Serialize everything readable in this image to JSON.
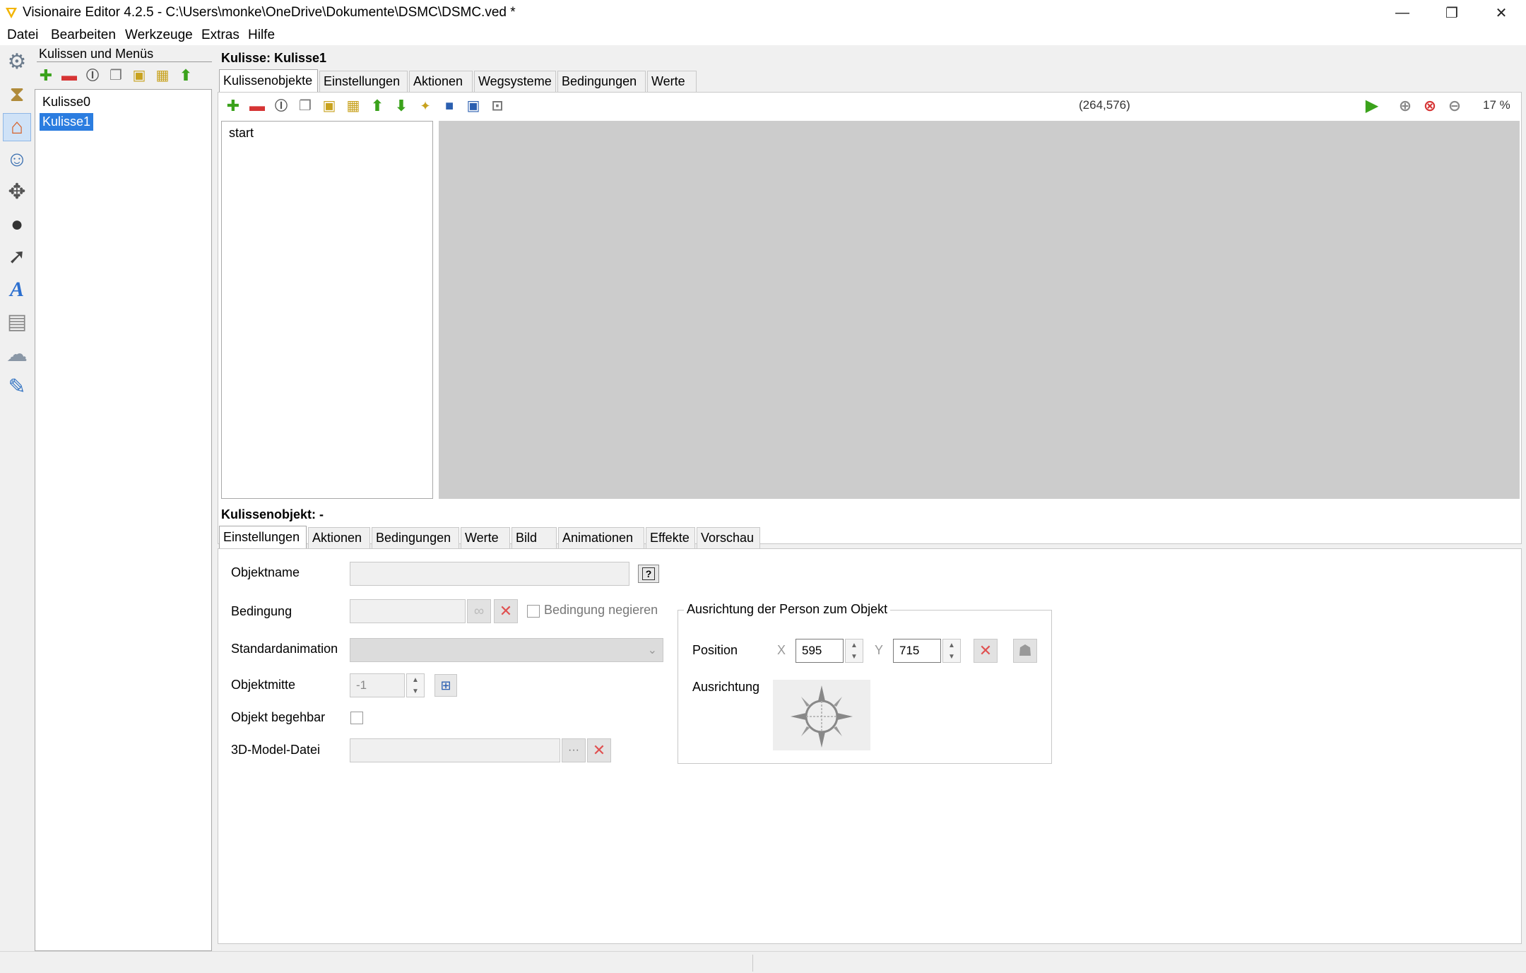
{
  "window": {
    "title": "Visionaire Editor 4.2.5 - C:\\Users\\monke\\OneDrive\\Dokumente\\DSMC\\DSMC.ved *",
    "minimize_glyph": "—",
    "restore_glyph": "❐",
    "close_glyph": "✕"
  },
  "menu": [
    "Datei",
    "Bearbeiten",
    "Werkzeuge",
    "Extras",
    "Hilfe"
  ],
  "rail_icons": [
    "gear-icon",
    "hourglass-icon",
    "home-icon",
    "character-icon",
    "gamepad-icon",
    "ball-icon",
    "cursor-icon",
    "font-icon",
    "text-document-icon",
    "weather-icon",
    "script-icon"
  ],
  "scenes_panel": {
    "title": "Kulissen und Menüs",
    "items": [
      "Kulisse0",
      "Kulisse1"
    ],
    "selected": "Kulisse1"
  },
  "scene": {
    "header": "Kulisse: Kulisse1",
    "tabs": [
      "Kulissenobjekte",
      "Einstellungen",
      "Aktionen",
      "Wegsysteme",
      "Bedingungen",
      "Werte"
    ],
    "active_tab": "Kulissenobjekte",
    "objects": [
      "start"
    ],
    "coordinates": "(264,576)",
    "zoom": "17 %"
  },
  "object": {
    "header": "Kulissenobjekt: -",
    "tabs": [
      "Einstellungen",
      "Aktionen",
      "Bedingungen",
      "Werte",
      "Bild",
      "Animationen",
      "Effekte",
      "Vorschau"
    ],
    "active_tab": "Einstellungen",
    "labels": {
      "name": "Objektname",
      "condition": "Bedingung",
      "negate": "Bedingung negieren",
      "animation": "Standardanimation",
      "center": "Objektmitte",
      "walkable": "Objekt begehbar",
      "model": "3D-Model-Datei"
    },
    "center_value": "-1",
    "help_glyph": "?",
    "browse_glyph": "···",
    "link_glyph": "∞"
  },
  "orientation": {
    "group_title": "Ausrichtung der Person zum Objekt",
    "position_label": "Position",
    "x_label": "X",
    "x_value": "595",
    "y_label": "Y",
    "y_value": "715",
    "direction_label": "Ausrichtung",
    "direction_value": "-"
  },
  "colors": {
    "accent": "#2b7de0",
    "canvas": "#cccccc",
    "green": "#3aa21b",
    "red": "#d63434"
  }
}
